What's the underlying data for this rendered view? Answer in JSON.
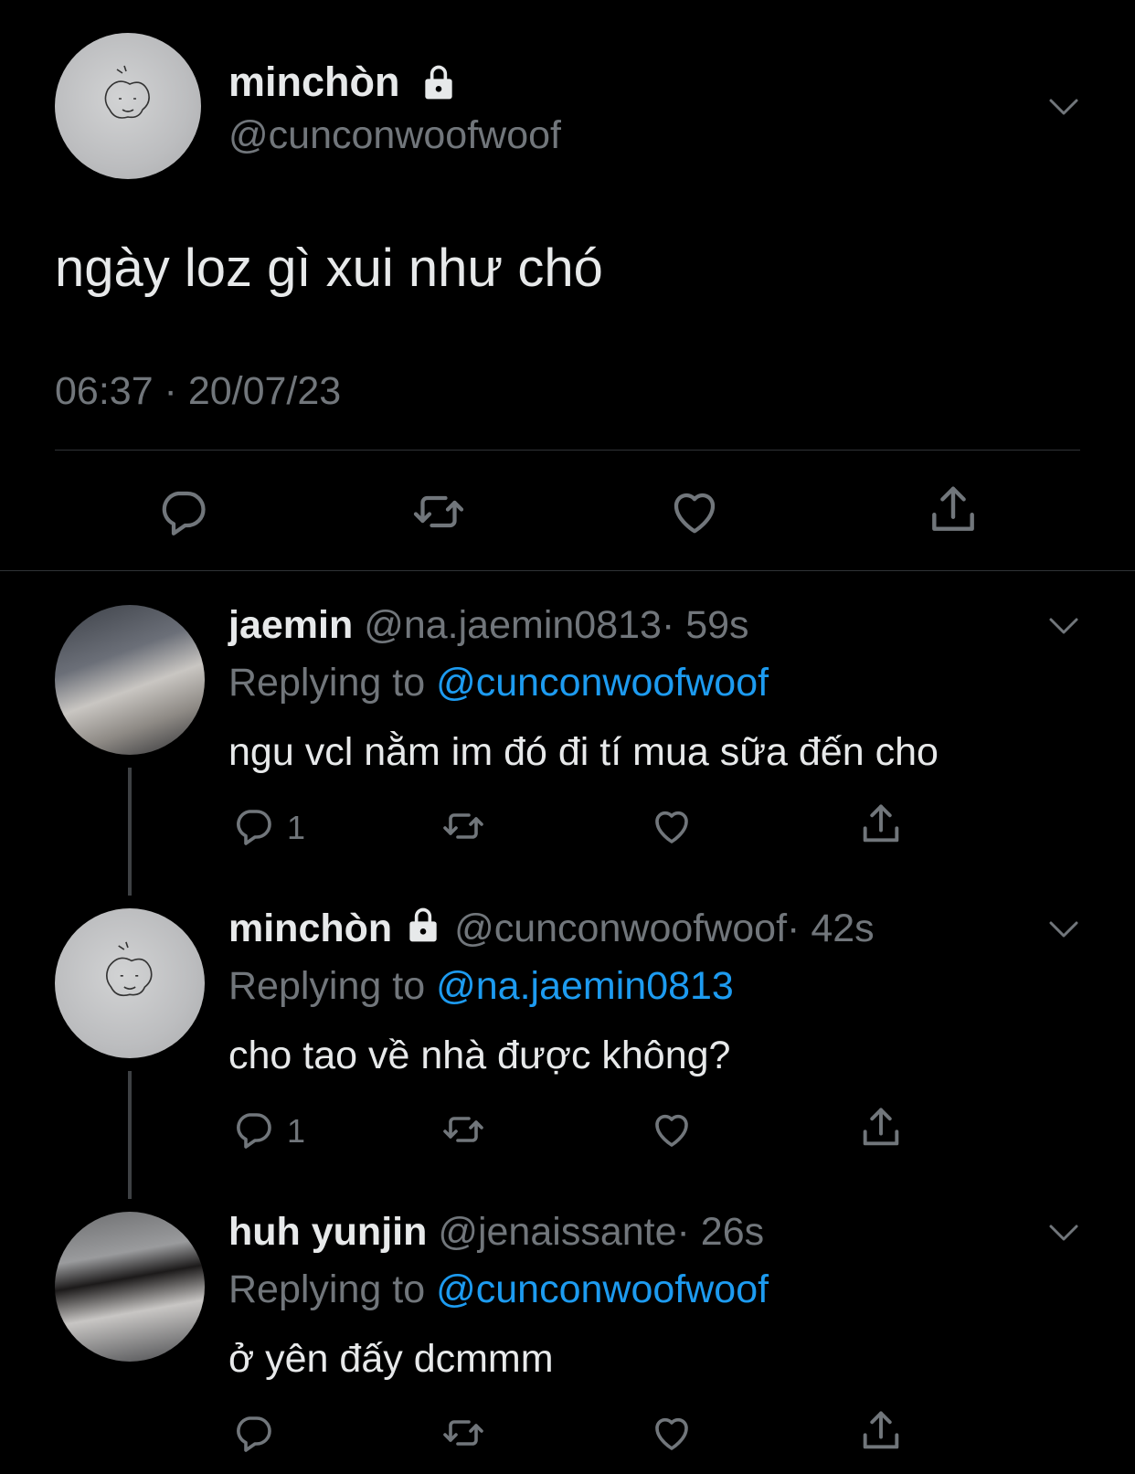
{
  "main_tweet": {
    "display_name": "minchòn",
    "handle": "@cunconwoofwoof",
    "text": "ngày loz gì xui như chó",
    "timestamp": "06:37 · 20/07/23"
  },
  "replies": [
    {
      "display_name": "jaemin",
      "handle": "@na.jaemin0813",
      "time": "· 59s",
      "replying_prefix": "Replying to",
      "replying_to": "@cunconwoofwoof",
      "text": "ngu vcl nằm im đó đi tí mua sữa đến cho",
      "reply_count": "1",
      "locked": false
    },
    {
      "display_name": "minchòn",
      "handle": "@cunconwoofwoof",
      "time": "· 42s",
      "replying_prefix": "Replying to",
      "replying_to": "@na.jaemin0813",
      "text": "cho tao về nhà được không?",
      "reply_count": "1",
      "locked": true
    },
    {
      "display_name": "huh yunjin",
      "handle": "@jenaissante",
      "time": "· 26s",
      "replying_prefix": "Replying to",
      "replying_to": "@cunconwoofwoof",
      "text": "ở yên đấy dcmmm",
      "reply_count": "",
      "locked": false
    }
  ],
  "colors": {
    "background": "#000000",
    "text": "#e7e9ea",
    "muted": "#71767b",
    "link": "#1d9bf0",
    "divider": "#2f3336"
  },
  "icons": [
    "lock-icon",
    "chevron-down-icon",
    "reply-icon",
    "retweet-icon",
    "like-icon",
    "share-icon"
  ]
}
